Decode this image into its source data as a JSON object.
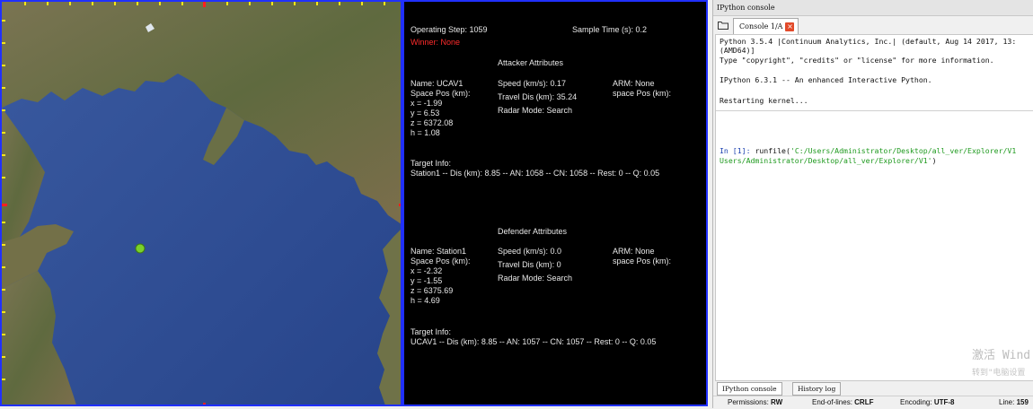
{
  "info": {
    "operating_step": "Operating Step: 1059",
    "sample_time": "Sample Time (s): 0.2",
    "winner": "Winner: None",
    "attacker": {
      "heading": "Attacker Attributes",
      "name": "Name: UCAV1",
      "space_pos": "Space Pos (km):",
      "x": "x = -1.99",
      "y": "y = 6.53",
      "z": "z = 6372.08",
      "h": "h = 1.08",
      "speed": "Speed (km/s): 0.17",
      "travel": "Travel Dis (km): 35.24",
      "radar": "Radar Mode: Search",
      "arm": "ARM: None",
      "arm_pos": "space Pos (km):",
      "target_label": "Target Info:",
      "target_line": "Station1 -- Dis (km): 8.85 -- AN: 1058 -- CN: 1058 -- Rest: 0 -- Q: 0.05"
    },
    "defender": {
      "heading": "Defender Attributes",
      "name": "Name: Station1",
      "space_pos": "Space Pos (km):",
      "x": "x = -2.32",
      "y": "y = -1.55",
      "z": "z = 6375.69",
      "h": "h = 4.69",
      "speed": "Speed (km/s): 0.0",
      "travel": "Travel Dis (km): 0",
      "radar": "Radar Mode: Search",
      "arm": "ARM: None",
      "arm_pos": "space Pos (km):",
      "target_label": "Target Info:",
      "target_line": "UCAV1 -- Dis (km): 8.85 -- AN: 1057 -- CN: 1057 -- Rest: 0 -- Q: 0.05"
    }
  },
  "console": {
    "pane_title": "IPython console",
    "tab_label": "Console 1/A",
    "tab_close_icon": "close-icon",
    "lines": {
      "l1": "Python 3.5.4 |Continuum Analytics, Inc.| (default, Aug 14 2017, 13:",
      "l2": "(AMD64)]",
      "l3": "Type \"copyright\", \"credits\" or \"license\" for more information.",
      "l4": "IPython 6.3.1 -- An enhanced Interactive Python.",
      "l5": "Restarting kernel...",
      "prompt": "In [1]:",
      "cmd": " runfile(",
      "arg1": "'C:/Users/Administrator/Desktop/all_ver/Explorer/V1",
      "arg2": "Users/Administrator/Desktop/all_ver/Explorer/V1'",
      "close_paren": ")"
    },
    "watermark_line1": "激活 Wind",
    "watermark_line2": "转到\"电脑设置",
    "bottom_tabs": [
      "IPython console",
      "History log"
    ],
    "status": {
      "permissions_label": "Permissions:",
      "permissions_value": "RW",
      "eol_label": "End-of-lines:",
      "eol_value": "CRLF",
      "encoding_label": "Encoding:",
      "encoding_value": "UTF-8",
      "line_label": "Line:",
      "line_value": "159"
    }
  },
  "colors": {
    "border_blue": "#2030ff",
    "winner_red": "#ff2b2b",
    "sea": "#2e4f93",
    "land": "#6b6a45",
    "string_green": "#1f9a1f",
    "prompt_blue": "#1a3fb0"
  }
}
